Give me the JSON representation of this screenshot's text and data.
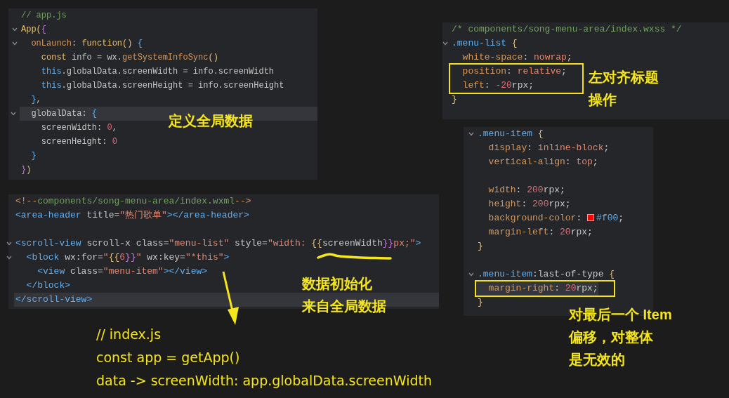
{
  "panels": [
    {
      "lines": [
        {
          "tokens": [
            {
              "text": "// app.js",
              "kind": "comment"
            }
          ],
          "fold": false,
          "highlighted": false,
          "boxed": false
        },
        {
          "tokens": [
            {
              "text": "App(",
              "kind": "function"
            },
            {
              "text": "{",
              "kind": "bracket"
            }
          ],
          "fold": true,
          "highlighted": false,
          "boxed": false
        },
        {
          "tokens": [
            {
              "text": "  onLaunch",
              "kind": "property"
            },
            {
              "text": ": ",
              "kind": "plain"
            },
            {
              "text": "function() ",
              "kind": "function"
            },
            {
              "text": "{",
              "kind": "keyword"
            }
          ],
          "fold": true,
          "highlighted": false,
          "boxed": false
        },
        {
          "tokens": [
            {
              "text": "    const",
              "kind": "function"
            },
            {
              "text": " info = wx.",
              "kind": "plain"
            },
            {
              "text": "getSystemInfoSync",
              "kind": "property"
            },
            {
              "text": "()",
              "kind": "function"
            }
          ],
          "fold": false,
          "highlighted": false,
          "boxed": false
        },
        {
          "tokens": [
            {
              "text": "    this",
              "kind": "keyword"
            },
            {
              "text": ".globalData.screenWidth = info.screenWidth",
              "kind": "plain"
            }
          ],
          "fold": false,
          "highlighted": false,
          "boxed": false
        },
        {
          "tokens": [
            {
              "text": "    this",
              "kind": "keyword"
            },
            {
              "text": ".globalData.screenHeight = info.screenHeight",
              "kind": "plain"
            }
          ],
          "fold": false,
          "highlighted": false,
          "boxed": false
        },
        {
          "tokens": [
            {
              "text": "  }",
              "kind": "keyword"
            },
            {
              "text": ",",
              "kind": "plain"
            }
          ],
          "fold": false,
          "highlighted": false,
          "boxed": false
        },
        {
          "tokens": [
            {
              "text": "  globalData: ",
              "kind": "plain"
            },
            {
              "text": "{",
              "kind": "keyword"
            }
          ],
          "fold": true,
          "highlighted": true,
          "boxed": false
        },
        {
          "tokens": [
            {
              "text": "    screenWidth: ",
              "kind": "plain"
            },
            {
              "text": "0",
              "kind": "number"
            },
            {
              "text": ",",
              "kind": "plain"
            }
          ],
          "fold": false,
          "highlighted": false,
          "boxed": false
        },
        {
          "tokens": [
            {
              "text": "    screenHeight: ",
              "kind": "plain"
            },
            {
              "text": "0",
              "kind": "number"
            }
          ],
          "fold": false,
          "highlighted": false,
          "boxed": false
        },
        {
          "tokens": [
            {
              "text": "  }",
              "kind": "keyword"
            }
          ],
          "fold": false,
          "highlighted": false,
          "boxed": false
        },
        {
          "tokens": [
            {
              "text": "}",
              "kind": "bracket"
            },
            {
              "text": ")",
              "kind": "function"
            }
          ],
          "fold": false,
          "highlighted": false,
          "boxed": false
        }
      ]
    },
    {
      "lines": [
        {
          "tokens": [
            {
              "text": "<!--",
              "kind": "property"
            },
            {
              "text": "components/song-menu-area/index.wxml",
              "kind": "comment"
            },
            {
              "text": "-->",
              "kind": "property"
            }
          ],
          "fold": false,
          "highlighted": false,
          "boxed": false
        },
        {
          "tokens": [
            {
              "text": "<area-header",
              "kind": "keyword"
            },
            {
              "text": " title=",
              "kind": "plain"
            },
            {
              "text": "\"热门歌单\"",
              "kind": "string"
            },
            {
              "text": "></area-header>",
              "kind": "keyword"
            }
          ],
          "fold": false,
          "highlighted": false,
          "boxed": false
        },
        {
          "fold": false,
          "highlighted": false,
          "boxed": false
        },
        {
          "tokens": [
            {
              "text": "<scroll-view",
              "kind": "keyword"
            },
            {
              "text": " scroll-x class=",
              "kind": "plain"
            },
            {
              "text": "\"menu-list\"",
              "kind": "string"
            },
            {
              "text": " style=",
              "kind": "plain"
            },
            {
              "text": "\"width: ",
              "kind": "string"
            },
            {
              "text": "{{",
              "kind": "function"
            },
            {
              "text": "screenWidth",
              "kind": "plain"
            },
            {
              "text": "}}",
              "kind": "bracket"
            },
            {
              "text": "px;\"",
              "kind": "string"
            },
            {
              "text": ">",
              "kind": "keyword"
            }
          ],
          "fold": true,
          "highlighted": false,
          "boxed": false
        },
        {
          "tokens": [
            {
              "text": "  <block",
              "kind": "keyword"
            },
            {
              "text": " wx:for=",
              "kind": "plain"
            },
            {
              "text": "\"",
              "kind": "string"
            },
            {
              "text": "{{",
              "kind": "function"
            },
            {
              "text": "6",
              "kind": "number"
            },
            {
              "text": "}}",
              "kind": "bracket"
            },
            {
              "text": "\"",
              "kind": "string"
            },
            {
              "text": " wx:key=",
              "kind": "plain"
            },
            {
              "text": "\"*this\"",
              "kind": "string"
            },
            {
              "text": ">",
              "kind": "keyword"
            }
          ],
          "fold": true,
          "highlighted": false,
          "boxed": false
        },
        {
          "tokens": [
            {
              "text": "    <view",
              "kind": "keyword"
            },
            {
              "text": " class=",
              "kind": "plain"
            },
            {
              "text": "\"menu-item\"",
              "kind": "string"
            },
            {
              "text": "></view>",
              "kind": "keyword"
            }
          ],
          "fold": false,
          "highlighted": false,
          "boxed": false
        },
        {
          "tokens": [
            {
              "text": "  </block>",
              "kind": "keyword"
            }
          ],
          "fold": false,
          "highlighted": false,
          "boxed": false
        },
        {
          "tokens": [
            {
              "text": "</scroll-view>",
              "kind": "keyword"
            }
          ],
          "fold": false,
          "highlighted": true,
          "boxed": false
        }
      ]
    },
    {
      "lines": [
        {
          "tokens": [
            {
              "text": "/* components/song-menu-area/index.wxss */",
              "kind": "comment"
            }
          ],
          "fold": false,
          "highlighted": false,
          "boxed": false
        },
        {
          "tokens": [
            {
              "text": ".menu-list ",
              "kind": "keyword"
            },
            {
              "text": "{",
              "kind": "function"
            }
          ],
          "fold": true,
          "highlighted": false,
          "boxed": false
        },
        {
          "tokens": [
            {
              "text": "  white-space",
              "kind": "property"
            },
            {
              "text": ": ",
              "kind": "plain"
            },
            {
              "text": "nowrap",
              "kind": "string"
            },
            {
              "text": ";",
              "kind": "plain"
            }
          ],
          "fold": false,
          "highlighted": false,
          "boxed": false
        },
        {
          "tokens": [
            {
              "text": "  position",
              "kind": "property"
            },
            {
              "text": ": ",
              "kind": "plain"
            },
            {
              "text": "relative",
              "kind": "string"
            },
            {
              "text": ";",
              "kind": "plain"
            }
          ],
          "fold": false,
          "highlighted": false,
          "boxed": true
        },
        {
          "tokens": [
            {
              "text": "  left",
              "kind": "property"
            },
            {
              "text": ": ",
              "kind": "plain"
            },
            {
              "text": "-20",
              "kind": "number"
            },
            {
              "text": "rpx;",
              "kind": "plain"
            }
          ],
          "fold": false,
          "highlighted": false,
          "boxed": true
        },
        {
          "tokens": [
            {
              "text": "}",
              "kind": "function"
            }
          ],
          "fold": false,
          "highlighted": false,
          "boxed": false
        }
      ]
    },
    {
      "lines": [
        {
          "tokens": [
            {
              "text": ".menu-item ",
              "kind": "keyword"
            },
            {
              "text": "{",
              "kind": "function"
            }
          ],
          "fold": true,
          "highlighted": false,
          "boxed": false
        },
        {
          "tokens": [
            {
              "text": "  display",
              "kind": "property"
            },
            {
              "text": ": ",
              "kind": "plain"
            },
            {
              "text": "inline-block",
              "kind": "string"
            },
            {
              "text": ";",
              "kind": "plain"
            }
          ],
          "fold": false,
          "highlighted": false,
          "boxed": false
        },
        {
          "tokens": [
            {
              "text": "  vertical-align",
              "kind": "property"
            },
            {
              "text": ": ",
              "kind": "plain"
            },
            {
              "text": "top",
              "kind": "string"
            },
            {
              "text": ";",
              "kind": "plain"
            }
          ],
          "fold": false,
          "highlighted": false,
          "boxed": false
        },
        {
          "fold": false,
          "highlighted": false,
          "boxed": false
        },
        {
          "tokens": [
            {
              "text": "  width",
              "kind": "property"
            },
            {
              "text": ": ",
              "kind": "plain"
            },
            {
              "text": "200",
              "kind": "number"
            },
            {
              "text": "rpx;",
              "kind": "plain"
            }
          ],
          "fold": false,
          "highlighted": false,
          "boxed": false
        },
        {
          "tokens": [
            {
              "text": "  height",
              "kind": "property"
            },
            {
              "text": ": ",
              "kind": "plain"
            },
            {
              "text": "200",
              "kind": "number"
            },
            {
              "text": "rpx;",
              "kind": "plain"
            }
          ],
          "fold": false,
          "highlighted": false,
          "boxed": false
        },
        {
          "tokens": [
            {
              "text": "  background-color",
              "kind": "property"
            },
            {
              "text": ": ",
              "kind": "plain"
            },
            {
              "text": "#f00",
              "kind": "color"
            },
            {
              "text": ";",
              "kind": "plain"
            }
          ],
          "fold": false,
          "highlighted": false,
          "boxed": false
        },
        {
          "tokens": [
            {
              "text": "  margin-left",
              "kind": "property"
            },
            {
              "text": ": ",
              "kind": "plain"
            },
            {
              "text": "20",
              "kind": "number"
            },
            {
              "text": "rpx;",
              "kind": "plain"
            }
          ],
          "fold": false,
          "highlighted": false,
          "boxed": false
        },
        {
          "tokens": [
            {
              "text": "}",
              "kind": "function"
            }
          ],
          "fold": false,
          "highlighted": false,
          "boxed": false
        },
        {
          "fold": false,
          "highlighted": false,
          "boxed": false
        },
        {
          "tokens": [
            {
              "text": ".menu-item",
              "kind": "keyword"
            },
            {
              "text": ":last-of-type ",
              "kind": "plain"
            },
            {
              "text": "{",
              "kind": "function"
            }
          ],
          "fold": true,
          "highlighted": false,
          "boxed": false
        },
        {
          "tokens": [
            {
              "text": "  margin-right",
              "kind": "property"
            },
            {
              "text": ": ",
              "kind": "plain"
            },
            {
              "text": "20",
              "kind": "number"
            },
            {
              "text": "rpx;",
              "kind": "plain"
            }
          ],
          "fold": false,
          "highlighted": true,
          "boxed": true
        },
        {
          "tokens": [
            {
              "text": "}",
              "kind": "function"
            }
          ],
          "fold": false,
          "highlighted": false,
          "boxed": false
        }
      ]
    }
  ],
  "notes": [
    {
      "lines": [
        "定义全局数据"
      ]
    },
    {
      "lines": [
        "数据初始化",
        "来自全局数据"
      ]
    },
    {
      "lines": [
        "左对齐标题",
        "操作"
      ]
    },
    {
      "lines": [
        "对最后一个 Item",
        "偏移，对整体",
        "是无效的"
      ]
    }
  ],
  "bottom_code": {
    "lines": [
      "// index.js",
      "const app = getApp()",
      "data -> screenWidth: app.globalData.screenWidth"
    ]
  }
}
